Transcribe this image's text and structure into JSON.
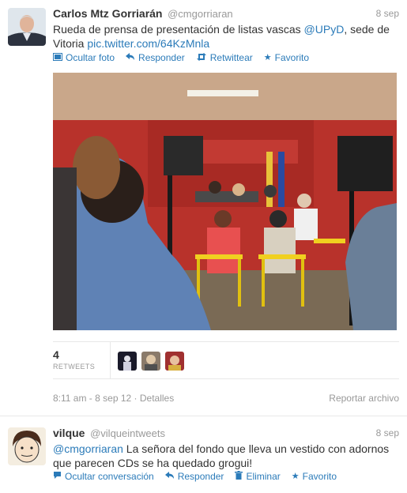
{
  "tweet1": {
    "fullname": "Carlos Mtz Gorriarán",
    "username": "@cmgorriaran",
    "time": "8 sep",
    "text_before": "Rueda de prensa de presentación de listas vascas ",
    "mention": "@UPyD",
    "text_middle": ", sede de Vitoria ",
    "url": "pic.twitter.com/64KzMnla",
    "actions": {
      "hide_photo": "Ocultar foto",
      "reply": "Responder",
      "retweet": "Retwittear",
      "favorite": "Favorito"
    },
    "retweet_count": "4",
    "retweet_label": "RETWEETS",
    "timestamp": "8:11 am - 8 sep 12",
    "details": "Detalles",
    "report": "Reportar archivo"
  },
  "tweet2": {
    "fullname": "vilque",
    "username": "@vilqueintweets",
    "time": "8 sep",
    "mention": "@cmgorriaran",
    "text": " La señora del fondo que lleva un vestido con adornos que parecen CDs se ha quedado grogui!",
    "actions": {
      "hide_conversation": "Ocultar conversación",
      "reply": "Responder",
      "delete": "Eliminar",
      "favorite": "Favorito"
    }
  },
  "icons": {
    "hide_photo": "photo-icon",
    "reply": "reply-icon",
    "retweet": "retweet-icon",
    "favorite": "star-icon",
    "conversation": "speech-bubble-icon",
    "delete": "trash-icon"
  },
  "colors": {
    "link": "#2b7bb9",
    "muted": "#999999",
    "text": "#333333"
  }
}
